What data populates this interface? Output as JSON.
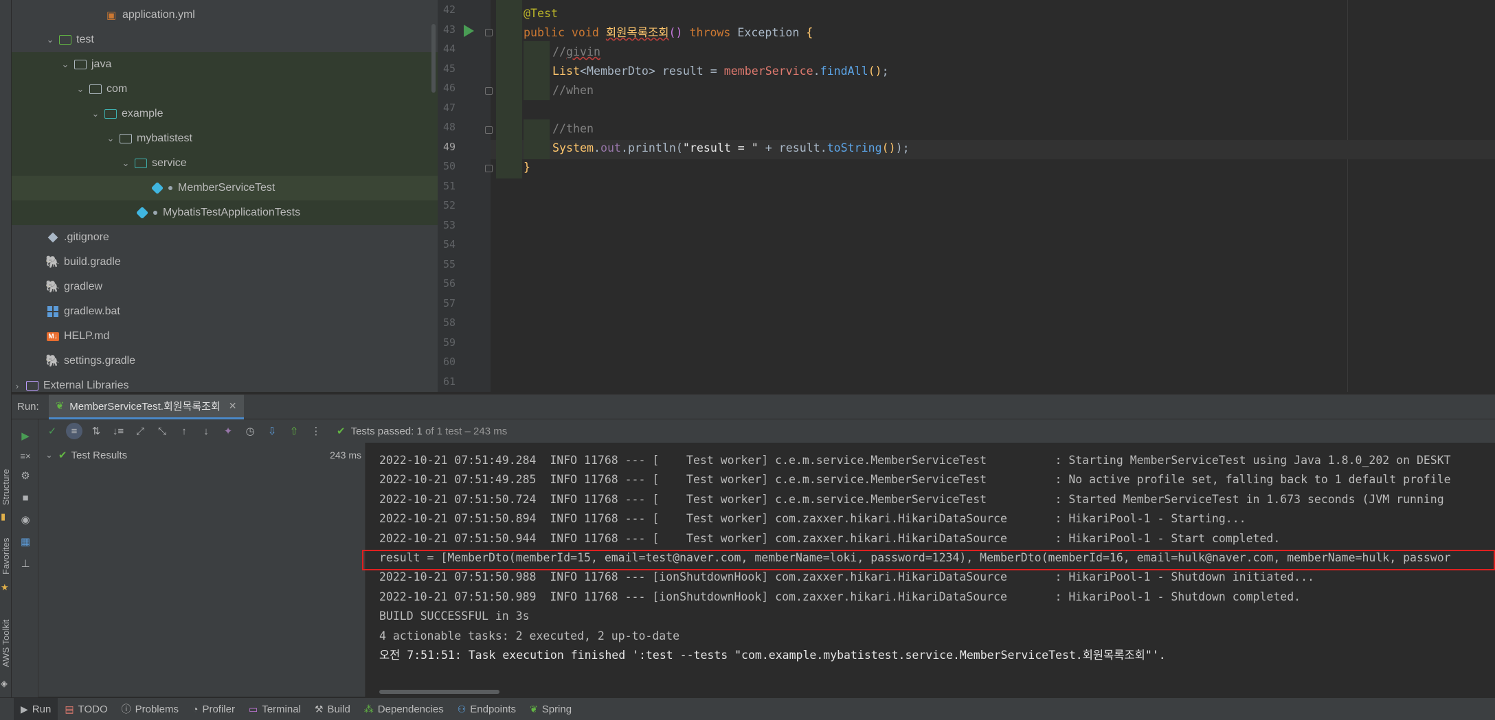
{
  "left_strip": {
    "structure": "Structure",
    "favorites": "Favorites",
    "aws": "AWS Toolkit"
  },
  "tree": [
    {
      "label": "application.yml",
      "icon": "yaml-file-icon",
      "chevron": ""
    },
    {
      "label": "test",
      "icon": "test-folder-icon",
      "chevron": "⌄"
    },
    {
      "label": "java",
      "icon": "folder-icon",
      "chevron": "⌄"
    },
    {
      "label": "com",
      "icon": "folder-icon",
      "chevron": "⌄"
    },
    {
      "label": "example",
      "icon": "package-folder-icon",
      "chevron": "⌄"
    },
    {
      "label": "mybatistest",
      "icon": "folder-icon",
      "chevron": "⌄"
    },
    {
      "label": "service",
      "icon": "package-folder-icon",
      "chevron": "⌄"
    },
    {
      "label": "MemberServiceTest",
      "icon": "test-class-icon",
      "chevron": ""
    },
    {
      "label": "MybatisTestApplicationTests",
      "icon": "test-class-icon",
      "chevron": ""
    },
    {
      "label": ".gitignore",
      "icon": "git-icon",
      "chevron": ""
    },
    {
      "label": "build.gradle",
      "icon": "gradle-icon",
      "chevron": ""
    },
    {
      "label": "gradlew",
      "icon": "gradle-icon",
      "chevron": ""
    },
    {
      "label": "gradlew.bat",
      "icon": "windows-icon",
      "chevron": ""
    },
    {
      "label": "HELP.md",
      "icon": "markdown-icon",
      "chevron": ""
    },
    {
      "label": "settings.gradle",
      "icon": "gradle-icon",
      "chevron": ""
    },
    {
      "label": "External Libraries",
      "icon": "library-icon",
      "chevron": "›"
    }
  ],
  "editor": {
    "line_numbers": [
      "42",
      "43",
      "44",
      "45",
      "46",
      "47",
      "48",
      "49",
      "50",
      "51",
      "52",
      "53",
      "54",
      "55",
      "56",
      "57",
      "58",
      "59",
      "60",
      "61"
    ],
    "current_line": "49"
  },
  "run": {
    "label": "Run:",
    "tab_label": "MemberServiceTest.회원목록조회",
    "tests_passed_prefix": "Tests passed:",
    "tests_passed_count": "1",
    "tests_passed_suffix": "of 1 test – 243 ms",
    "test_results_label": "Test Results",
    "test_results_time": "243 ms"
  },
  "console": [
    "2022-10-21 07:51:49.284  INFO 11768 --- [    Test worker] c.e.m.service.MemberServiceTest          : Starting MemberServiceTest using Java 1.8.0_202 on DESKT",
    "2022-10-21 07:51:49.285  INFO 11768 --- [    Test worker] c.e.m.service.MemberServiceTest          : No active profile set, falling back to 1 default profile",
    "2022-10-21 07:51:50.724  INFO 11768 --- [    Test worker] c.e.m.service.MemberServiceTest          : Started MemberServiceTest in 1.673 seconds (JVM running",
    "2022-10-21 07:51:50.894  INFO 11768 --- [    Test worker] com.zaxxer.hikari.HikariDataSource       : HikariPool-1 - Starting...",
    "2022-10-21 07:51:50.944  INFO 11768 --- [    Test worker] com.zaxxer.hikari.HikariDataSource       : HikariPool-1 - Start completed.",
    "result = [MemberDto(memberId=15, email=test@naver.com, memberName=loki, password=1234), MemberDto(memberId=16, email=hulk@naver.com, memberName=hulk, passwor",
    "2022-10-21 07:51:50.988  INFO 11768 --- [ionShutdownHook] com.zaxxer.hikari.HikariDataSource       : HikariPool-1 - Shutdown initiated...",
    "2022-10-21 07:51:50.989  INFO 11768 --- [ionShutdownHook] com.zaxxer.hikari.HikariDataSource       : HikariPool-1 - Shutdown completed.",
    "BUILD SUCCESSFUL in 3s",
    "4 actionable tasks: 2 executed, 2 up-to-date",
    "오전 7:51:51: Task execution finished ':test --tests \"com.example.mybatistest.service.MemberServiceTest.회원목록조회\"'."
  ],
  "bottom_tabs": [
    {
      "label": "Run",
      "icon": "run-icon"
    },
    {
      "label": "TODO",
      "icon": "todo-icon"
    },
    {
      "label": "Problems",
      "icon": "problems-icon"
    },
    {
      "label": "Profiler",
      "icon": "profiler-icon"
    },
    {
      "label": "Terminal",
      "icon": "terminal-icon"
    },
    {
      "label": "Build",
      "icon": "build-icon"
    },
    {
      "label": "Dependencies",
      "icon": "dependencies-icon"
    },
    {
      "label": "Endpoints",
      "icon": "endpoints-icon"
    },
    {
      "label": "Spring",
      "icon": "spring-icon"
    }
  ],
  "colors": {
    "accent": "#4a88c7",
    "success": "#62b543",
    "highlight_box": "#e02020"
  }
}
